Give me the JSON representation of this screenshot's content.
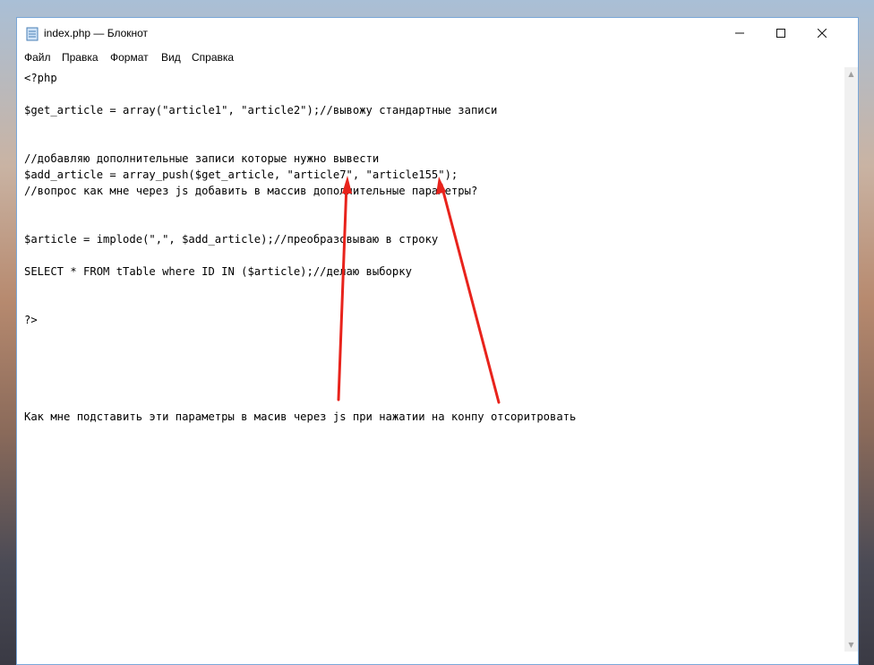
{
  "window": {
    "title": "index.php — Блокнот",
    "controls": {
      "minimize_icon": "minimize-icon",
      "maximize_icon": "maximize-icon",
      "close_icon": "close-icon"
    }
  },
  "menu": {
    "items": [
      {
        "label": "Файл"
      },
      {
        "label": "Правка"
      },
      {
        "label": "Формат"
      },
      {
        "label": "Вид"
      },
      {
        "label": "Справка"
      }
    ]
  },
  "document": {
    "lines": [
      "<?php",
      "$get_article = array(\"article1\", \"article2\");//вывожу стандартные записи",
      "//добавляю дополнительные записи которые нужно вывести",
      "$add_article = array_push($get_article, \"article7\", \"article155\");",
      "//вопрос как мне через js добавить в массив дополнительные параметры?",
      "$article = implode(\",\", $add_article);//преобразовываю в строку",
      "SELECT * FROM tTable where ID IN ($article);//делаю выборку",
      "?>",
      "Как мне подставить эти параметры в масив через js при нажатии на конпу отсоритровать"
    ]
  },
  "annotations": {
    "arrow_color": "#e8231c"
  }
}
